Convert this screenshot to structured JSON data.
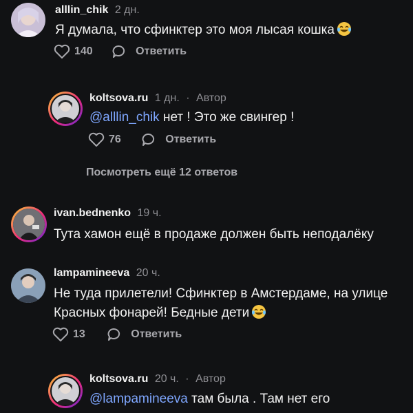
{
  "comments": [
    {
      "username": "alllin_chik",
      "time": "2 дн.",
      "text": "Я думала, что сфинктер это моя лысая кошка",
      "likes": "140",
      "reply_label": "Ответить"
    },
    {
      "username": "koltsova.ru",
      "time": "1 дн.",
      "separator": "·",
      "author_label": "Автор",
      "mention": "@alllin_chik",
      "text": " нет ! Это же свингер !",
      "likes": "76",
      "reply_label": "Ответить"
    },
    {
      "username": "ivan.bednenko",
      "time": "19 ч.",
      "text": "Тута хамон ещё в продаже должен быть неподалёку"
    },
    {
      "username": "lampamineeva",
      "time": "20 ч.",
      "text": "Не туда прилетели! Сфинктер в Амстердаме, на улице Красных фонарей! Бедные дети",
      "likes": "13",
      "reply_label": "Ответить"
    },
    {
      "username": "koltsova.ru",
      "time": "20 ч.",
      "separator": "·",
      "author_label": "Автор",
      "mention": "@lampamineeva",
      "text": " там была . Там нет его"
    }
  ],
  "view_more_replies": "Посмотреть ещё 12 ответов",
  "icons": {
    "like": "heart-outline-icon",
    "reply": "speech-bubble-icon",
    "emoji": "laughing-tears-emoji"
  },
  "colors": {
    "background": "#111214",
    "mention": "#7fa7ff",
    "secondary_text": "#8e8e93"
  }
}
